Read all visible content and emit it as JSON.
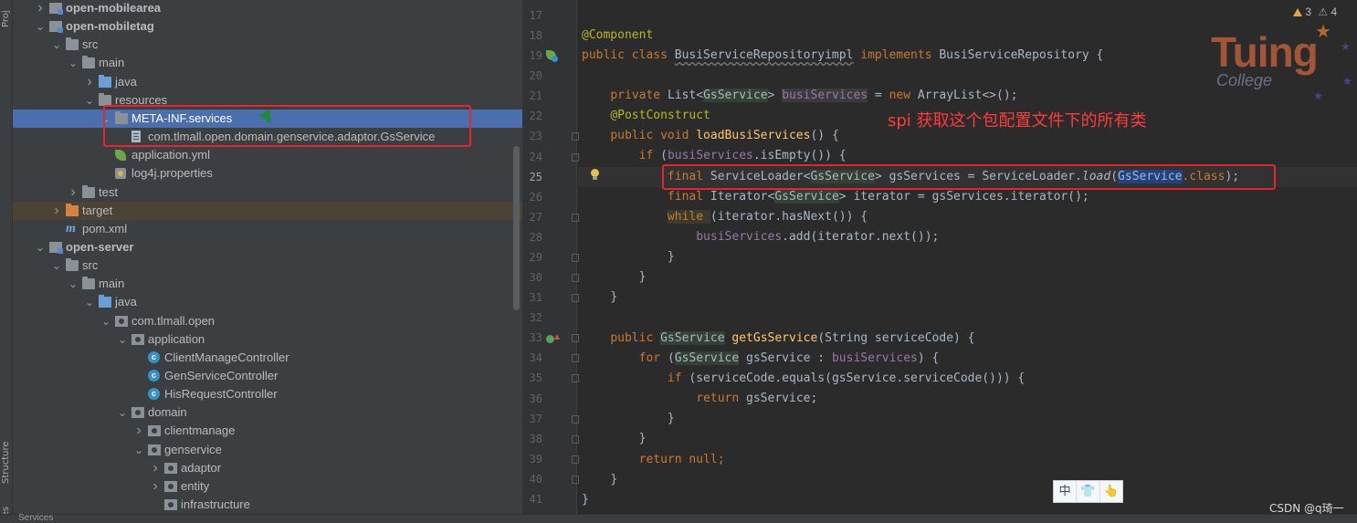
{
  "toolstrip": {
    "top_tab": "Proj",
    "structure_tab": "Structure",
    "favorites_tab": "ites"
  },
  "tree": {
    "rows": [
      {
        "label": "open-mobilearea",
        "bold": true,
        "depth": 1,
        "arrow": "right",
        "icon": "module-folder-icon"
      },
      {
        "label": "open-mobiletag",
        "bold": true,
        "depth": 1,
        "arrow": "down",
        "icon": "module-folder-icon"
      },
      {
        "label": "src",
        "depth": 2,
        "arrow": "down",
        "icon": "folder-icon"
      },
      {
        "label": "main",
        "depth": 3,
        "arrow": "down",
        "icon": "folder-icon"
      },
      {
        "label": "java",
        "depth": 4,
        "arrow": "right",
        "icon": "source-folder-icon"
      },
      {
        "label": "resources",
        "depth": 4,
        "arrow": "down",
        "icon": "folder-icon"
      },
      {
        "label": "META-INF.services",
        "depth": 5,
        "arrow": "down",
        "icon": "folder-icon",
        "selected": true
      },
      {
        "label": "com.tlmall.open.domain.genservice.adaptor.GsService",
        "depth": 6,
        "icon": "file-icon"
      },
      {
        "label": "application.yml",
        "depth": 5,
        "icon": "spring-leaf-icon"
      },
      {
        "label": "log4j.properties",
        "depth": 5,
        "icon": "properties-icon"
      },
      {
        "label": "test",
        "depth": 3,
        "arrow": "right",
        "icon": "folder-icon"
      },
      {
        "label": "target",
        "depth": 2,
        "arrow": "right",
        "icon": "excluded-folder-icon",
        "target": true
      },
      {
        "label": "pom.xml",
        "depth": 2,
        "icon": "maven-icon"
      },
      {
        "label": "open-server",
        "bold": true,
        "depth": 1,
        "arrow": "down",
        "icon": "module-folder-icon"
      },
      {
        "label": "src",
        "depth": 2,
        "arrow": "down",
        "icon": "folder-icon"
      },
      {
        "label": "main",
        "depth": 3,
        "arrow": "down",
        "icon": "folder-icon"
      },
      {
        "label": "java",
        "depth": 4,
        "arrow": "down",
        "icon": "source-folder-icon"
      },
      {
        "label": "com.tlmall.open",
        "depth": 5,
        "arrow": "down",
        "icon": "package-icon"
      },
      {
        "label": "application",
        "depth": 6,
        "arrow": "down",
        "icon": "package-icon"
      },
      {
        "label": "ClientManageController",
        "depth": 7,
        "icon": "class-icon"
      },
      {
        "label": "GenServiceController",
        "depth": 7,
        "icon": "class-icon"
      },
      {
        "label": "HisRequestController",
        "depth": 7,
        "icon": "class-icon"
      },
      {
        "label": "domain",
        "depth": 6,
        "arrow": "down",
        "icon": "package-icon"
      },
      {
        "label": "clientmanage",
        "depth": 7,
        "arrow": "right",
        "icon": "package-icon"
      },
      {
        "label": "genservice",
        "depth": 7,
        "arrow": "down",
        "icon": "package-icon"
      },
      {
        "label": "adaptor",
        "depth": 8,
        "arrow": "right",
        "icon": "package-icon"
      },
      {
        "label": "entity",
        "depth": 8,
        "arrow": "right",
        "icon": "package-icon"
      },
      {
        "label": "infrastructure",
        "depth": 8,
        "icon": "package-icon"
      }
    ]
  },
  "editor": {
    "line_numbers": [
      "17",
      "18",
      "19",
      "20",
      "21",
      "22",
      "23",
      "24",
      "25",
      "26",
      "27",
      "28",
      "29",
      "30",
      "31",
      "32",
      "33",
      "34",
      "35",
      "36",
      "37",
      "38",
      "39",
      "40",
      "41"
    ],
    "current_line": "25",
    "lines": {
      "l18": {
        "ann": "@Component"
      },
      "l19": {
        "kw1": "public class ",
        "cls": "BusiServiceRepositoryimpl",
        "kw2": " implements ",
        "iface": "BusiServiceRepository",
        "rest": " {"
      },
      "l21": {
        "kw": "private ",
        "t1": "List<",
        "type": "GsService",
        "t2": "> ",
        "field": "busiServices",
        "t3": " = ",
        "kwnew": "new ",
        "t4": "ArrayList<>();"
      },
      "l22": {
        "ann": "@PostConstruct"
      },
      "l23": {
        "kw": "public void ",
        "fn": "loadBusiServices",
        "rest": "() {"
      },
      "l24": {
        "kw": "if ",
        "t1": "(",
        "field": "busiServices",
        "t2": ".isEmpty()) {"
      },
      "l25": {
        "kw": "final ",
        "t1": "ServiceLoader<",
        "type": "GsService",
        "t2": "> gsServices = ServiceLoader.",
        "method": "load",
        "t3": "(",
        "sel": "GsService",
        "kwclass": ".class",
        "t4": ");"
      },
      "l26": {
        "kw": "final ",
        "t1": "Iterator<",
        "type": "GsService",
        "t2": "> iterator = gsServices.iterator();"
      },
      "l27": {
        "kw": "while ",
        "rest": "(iterator.hasNext()) {"
      },
      "l28": {
        "field": "busiServices",
        "rest": ".add(iterator.next());"
      },
      "l29": {
        "rest": "}"
      },
      "l30": {
        "rest": "}"
      },
      "l31": {
        "rest": "}"
      },
      "l33": {
        "kw": "public ",
        "type": "GsService",
        "sp": " ",
        "fn": "getGsService",
        "rest": "(String serviceCode) {"
      },
      "l34": {
        "kw": "for ",
        "t1": "(",
        "type": "GsService",
        "t2": " gsService : ",
        "field": "busiServices",
        "t3": ") {"
      },
      "l35": {
        "kw": "if ",
        "rest": "(serviceCode.equals(gsService.serviceCode())) {"
      },
      "l36": {
        "kw": "return ",
        "rest": "gsService;"
      },
      "l37": {
        "rest": "}"
      },
      "l38": {
        "rest": "}"
      },
      "l39": {
        "kw": "return null",
        "rest": ";"
      },
      "l40": {
        "rest": "}"
      },
      "l41": {
        "rest": "}"
      }
    }
  },
  "annotation_note": "spi 获取这个包配置文件下的所有类",
  "logo": {
    "title": "Tuing",
    "subtitle": "College"
  },
  "inspections": {
    "warnings": "3",
    "weak_warnings": "4"
  },
  "ime_bar": {
    "lang": "中",
    "shirt": "👕",
    "hand": "👆"
  },
  "watermark": "CSDN @q琦一",
  "bottom_bar": {
    "label": "Services"
  },
  "colors": {
    "accent_selected": "#4b6eaf",
    "highlight_red": "#e5272b",
    "editor_bg": "#2b2b2b",
    "tree_bg": "#3c3f41"
  }
}
